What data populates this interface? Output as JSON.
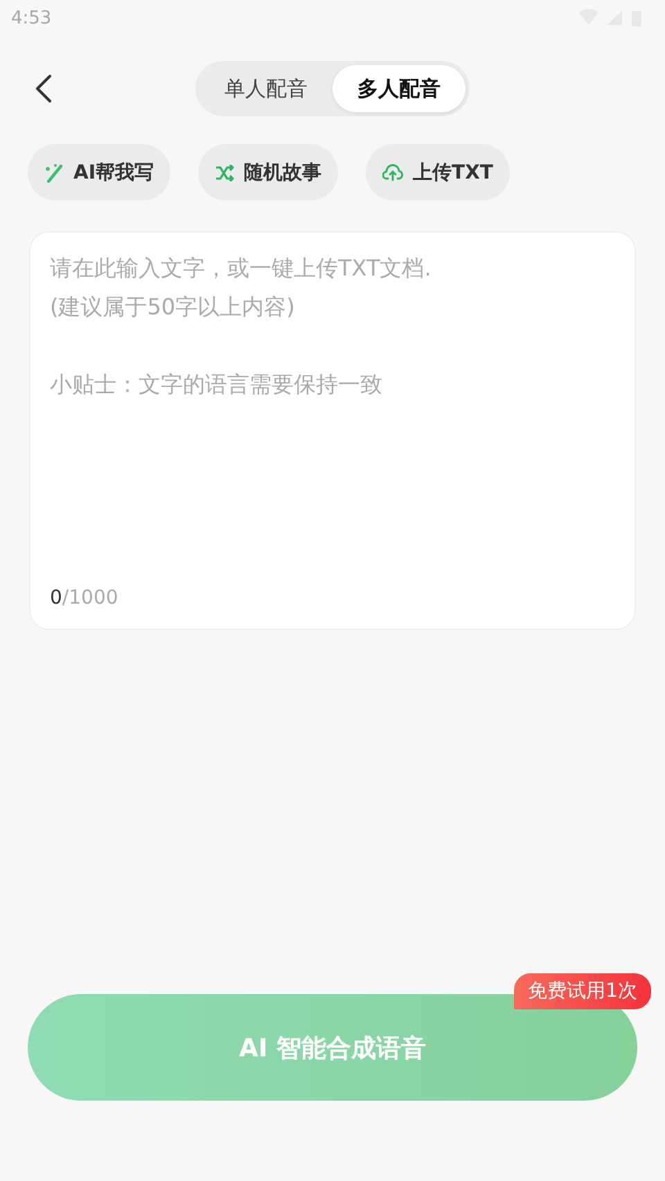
{
  "status_bar": {
    "time": "4:53"
  },
  "header": {
    "tabs": [
      {
        "label": "单人配音",
        "selected": false
      },
      {
        "label": "多人配音",
        "selected": true
      }
    ]
  },
  "actions": [
    {
      "kind": "magic",
      "label": "AI帮我写"
    },
    {
      "kind": "shuffle",
      "label": "随机故事"
    },
    {
      "kind": "upload",
      "label": "上传TXT"
    }
  ],
  "editor": {
    "placeholder": "请在此输入文字，或一键上传TXT文档.\n(建议属于50字以上内容)\n\n小贴士：文字的语言需要保持一致",
    "count": "0",
    "limit": "/1000"
  },
  "submit": {
    "label": "AI 智能合成语音",
    "disabled": true,
    "badge": "免费试用1次"
  }
}
